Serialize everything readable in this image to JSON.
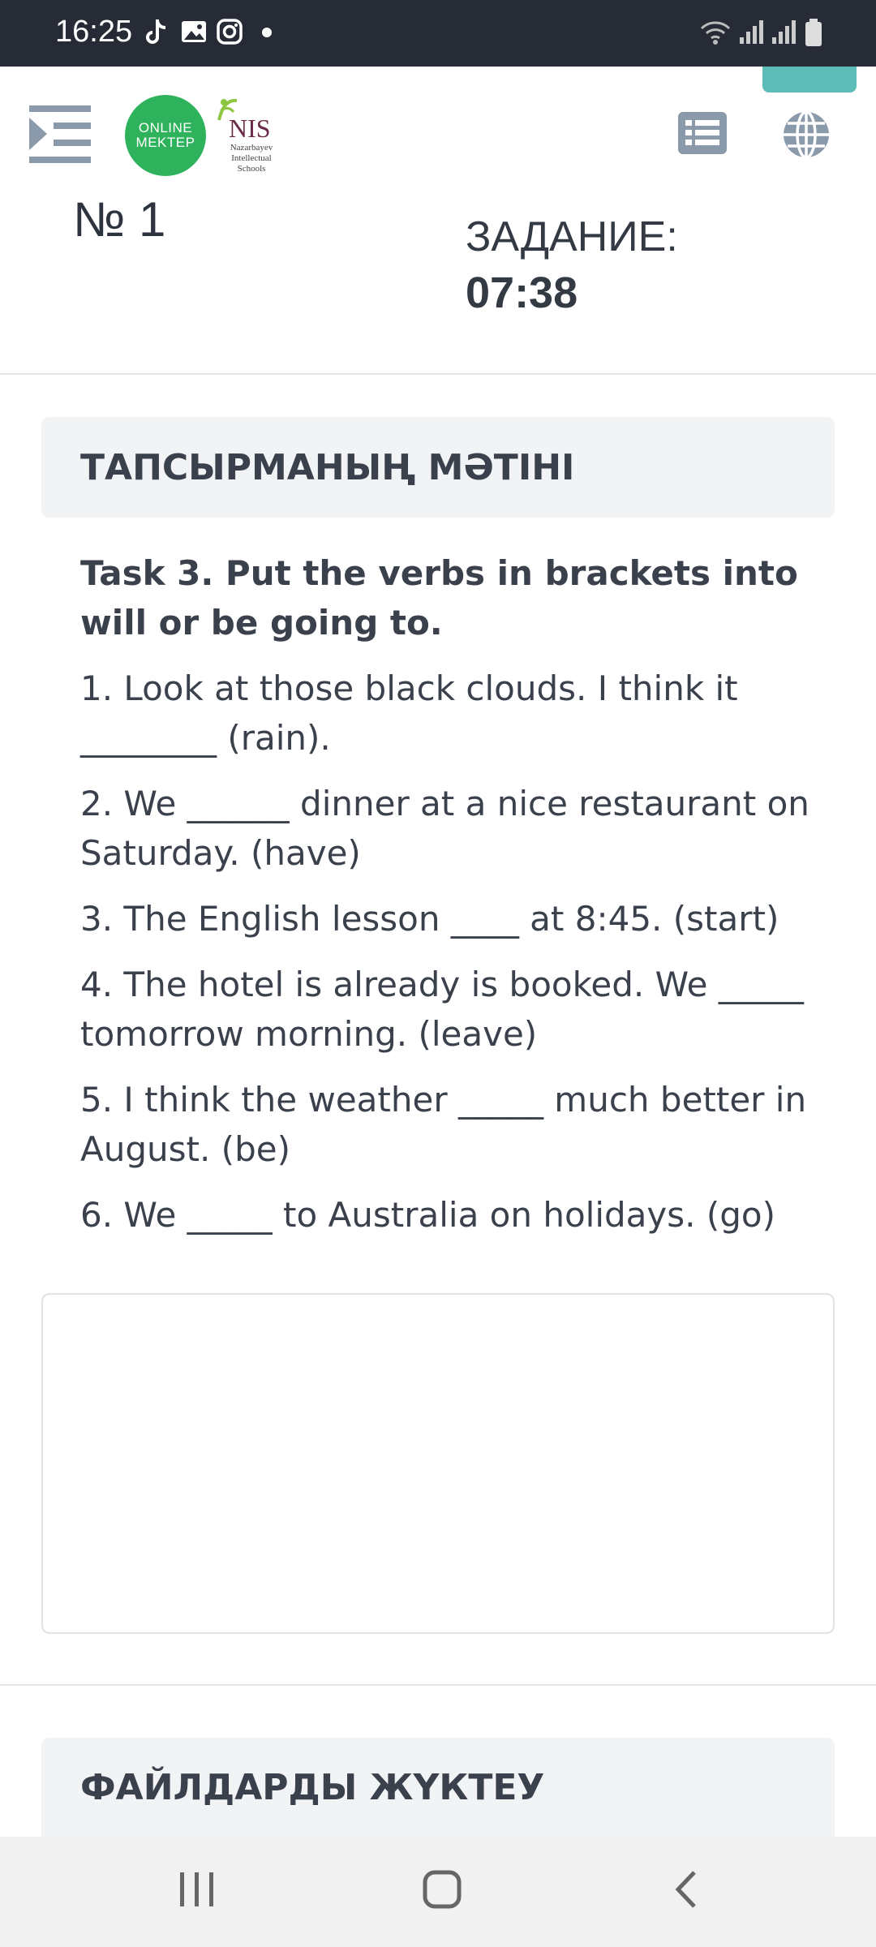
{
  "status_bar": {
    "time": "16:25",
    "left_icons": [
      "tiktok-icon",
      "gallery-icon",
      "instagram-icon",
      "dot-icon"
    ],
    "right_icons": [
      "wifi-icon",
      "signal-icon",
      "signal-icon",
      "battery-icon"
    ]
  },
  "header": {
    "logo_online": "ONLINE",
    "logo_mektep": "MEKTEP",
    "nis_title": "NIS",
    "nis_subtitle": "Nazarbayev Intellectual Schools"
  },
  "task_info": {
    "number": "№ 1",
    "label": "ЗАДАНИЕ:",
    "timer": "07:38"
  },
  "task_section": {
    "heading": "ТАПСЫРМАНЫҢ МӘТІНІ",
    "title": "Task 3. Put the verbs in brackets into will or be going to.",
    "items": [
      "1. Look at those black clouds. I think it ________ (rain).",
      "2. We ______ dinner at a nice restaurant on Saturday. (have)",
      "3. The English lesson ____ at 8:45. (start)",
      "4. The hotel is already is booked. We _____ tomorrow morning. (leave)",
      "5. I think the weather _____ much better in August. (be)",
      "6. We _____ to Australia on holidays. (go)"
    ]
  },
  "answer": {
    "value": ""
  },
  "files_section": {
    "heading": "ФАЙЛДАРДЫ ЖҮКТЕУ"
  },
  "colors": {
    "status_bar_bg": "#262b36",
    "logo_green": "#2fb25c",
    "accent_teal": "#5bbcb8",
    "icon_gray": "#8a9aab",
    "section_bg": "#f2f3f5"
  }
}
